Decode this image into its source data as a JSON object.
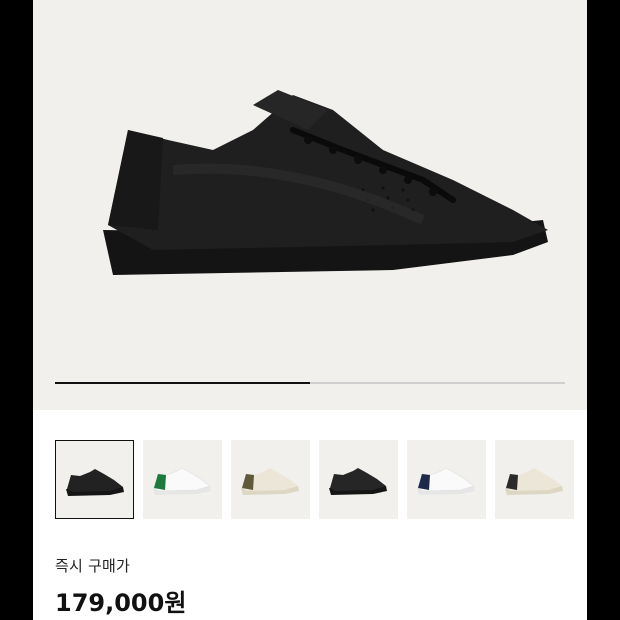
{
  "gallery": {
    "slide_progress": 0.5,
    "thumbnails": [
      {
        "name": "black-all",
        "selected": true
      },
      {
        "name": "white-green"
      },
      {
        "name": "cream-olive"
      },
      {
        "name": "black-black"
      },
      {
        "name": "white-navy"
      },
      {
        "name": "cream-black"
      }
    ]
  },
  "purchase": {
    "label": "즉시 구매가",
    "price": "179,000원"
  }
}
